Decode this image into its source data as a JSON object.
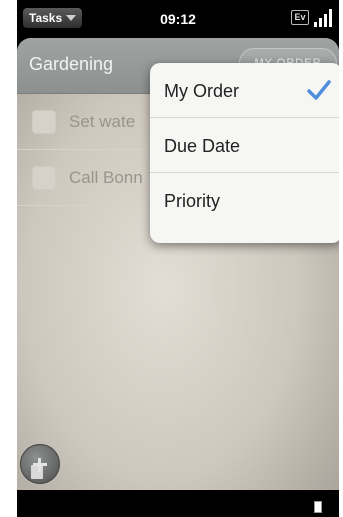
{
  "statusbar": {
    "app_name": "Tasks",
    "time": "09:12",
    "ev_badge": "Ev"
  },
  "header": {
    "title": "Gardening",
    "order_button": "MY ORDER"
  },
  "tasks": [
    {
      "label": "Set wate"
    },
    {
      "label": "Call Bonn"
    }
  ],
  "sort_menu": {
    "items": [
      {
        "label": "My Order",
        "selected": true
      },
      {
        "label": "Due Date",
        "selected": false
      },
      {
        "label": "Priority",
        "selected": false
      }
    ]
  },
  "colors": {
    "check_accent": "#4f8fdc",
    "header_bg": "#9fa3a2"
  },
  "icons": {
    "app_menu": "caret-down-icon",
    "signal": "signal-bars-icon",
    "add": "add-task-icon",
    "check": "checkmark-icon"
  }
}
